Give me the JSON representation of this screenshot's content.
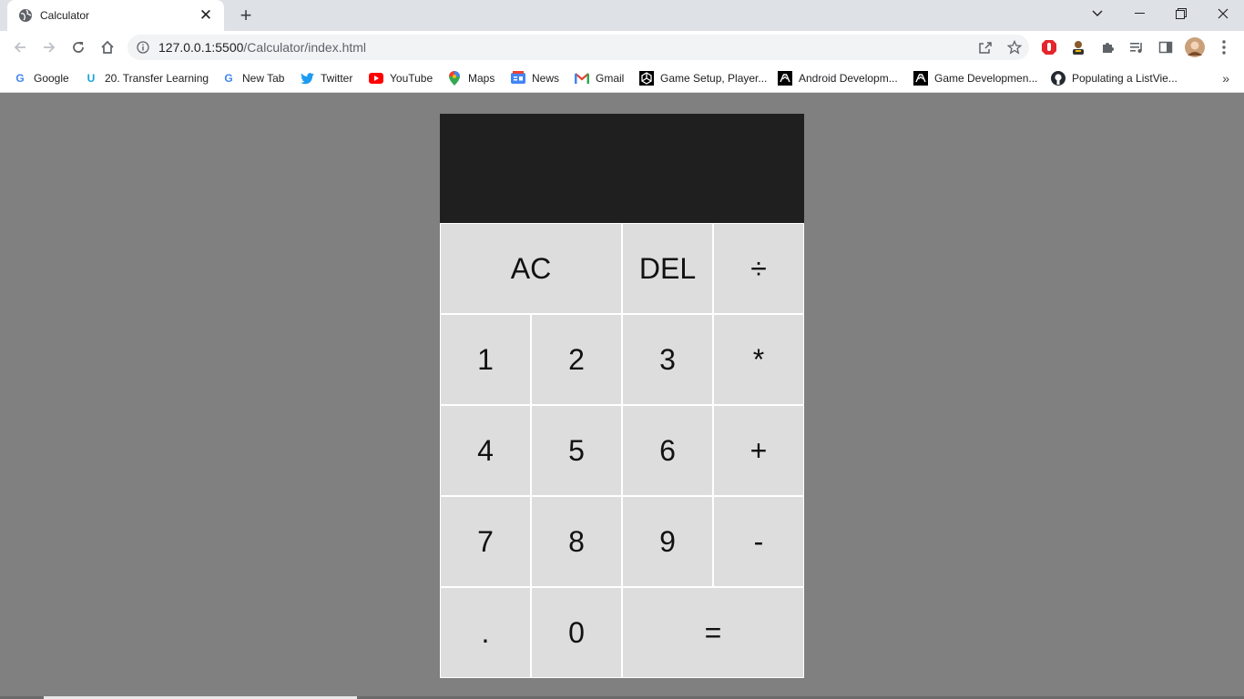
{
  "tab": {
    "title": "Calculator"
  },
  "address": {
    "host": "127.0.0.1:5500",
    "path": "/Calculator/index.html"
  },
  "bookmarks": [
    {
      "label": "Google",
      "icon": "google-icon",
      "color": "#4285f4"
    },
    {
      "label": "20. Transfer Learning",
      "icon": "udemy-icon",
      "color": "#18a2dd"
    },
    {
      "label": "New Tab",
      "icon": "google-icon",
      "color": "#4285f4"
    },
    {
      "label": "Twitter",
      "icon": "twitter-icon",
      "color": "#1d9bf0"
    },
    {
      "label": "YouTube",
      "icon": "youtube-icon",
      "color": "#ff0000"
    },
    {
      "label": "Maps",
      "icon": "maps-icon",
      "color": "#34a853"
    },
    {
      "label": "News",
      "icon": "news-icon",
      "color": "#4285f4"
    },
    {
      "label": "Gmail",
      "icon": "gmail-icon",
      "color": "#ea4335"
    },
    {
      "label": "Game Setup, Player...",
      "icon": "unity-icon",
      "color": "#000000"
    },
    {
      "label": "Android Developm...",
      "icon": "android-dev-icon",
      "color": "#000000"
    },
    {
      "label": "Game Developmen...",
      "icon": "game-dev-icon",
      "color": "#000000"
    },
    {
      "label": "Populating a ListVie...",
      "icon": "github-icon",
      "color": "#000000"
    }
  ],
  "calculator": {
    "previous_operand": "",
    "current_operand": "",
    "display_bg": "#1f1f1f",
    "key_bg": "#dddddd",
    "page_bg": "#808080",
    "keys": {
      "ac": "AC",
      "del": "DEL",
      "divide": "÷",
      "one": "1",
      "two": "2",
      "three": "3",
      "multiply": "*",
      "four": "4",
      "five": "5",
      "six": "6",
      "plus": "+",
      "seven": "7",
      "eight": "8",
      "nine": "9",
      "minus": "-",
      "dot": ".",
      "zero": "0",
      "equals": "="
    }
  }
}
